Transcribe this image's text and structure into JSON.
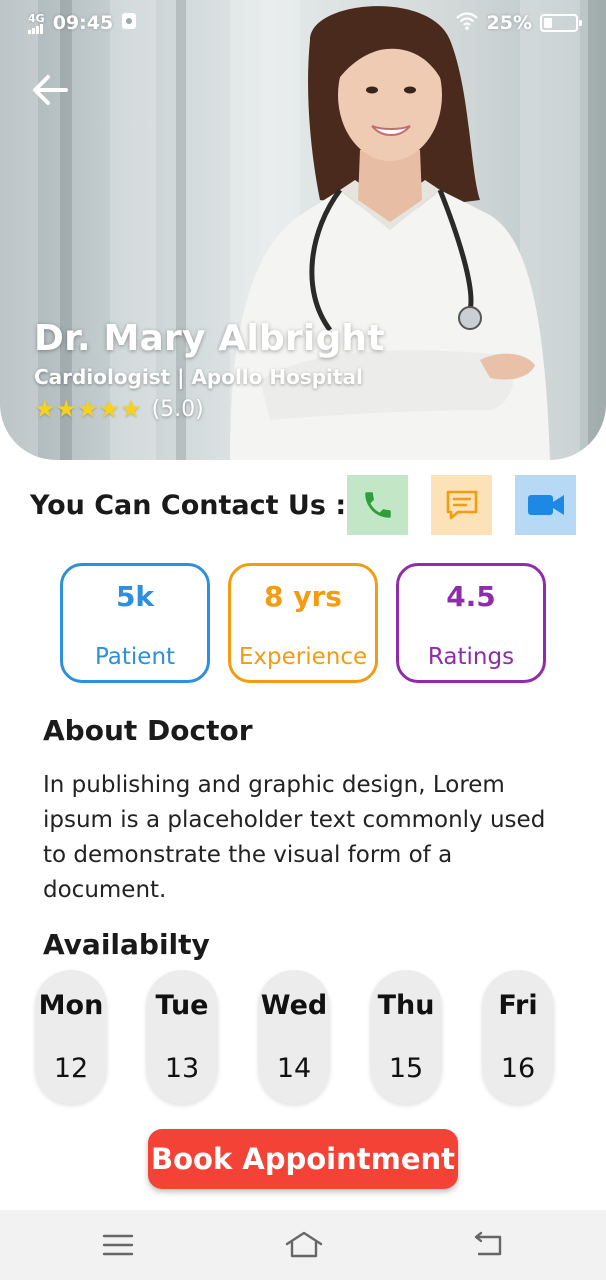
{
  "status_bar": {
    "network": "4G",
    "time": "09:45",
    "battery_text": "25%",
    "battery_level": 0.25,
    "icons": [
      "signal-icon",
      "notification-icon",
      "wifi-icon",
      "battery-icon"
    ]
  },
  "header": {
    "back_icon": "arrow-left-icon"
  },
  "doctor": {
    "name": "Dr. Mary Albright",
    "specialty": "Cardiologist | Apollo Hospital",
    "stars": 5,
    "rating_text": "(5.0)"
  },
  "contact": {
    "label": "You Can Contact Us :",
    "buttons": [
      {
        "name": "phone",
        "icon": "phone-icon",
        "color": "#2e9e3a",
        "bg": "#c3e6c6"
      },
      {
        "name": "chat",
        "icon": "chat-icon",
        "color": "#f39c12",
        "bg": "#fde2b8"
      },
      {
        "name": "video",
        "icon": "video-icon",
        "color": "#1e88e5",
        "bg": "#b8d9f6"
      }
    ]
  },
  "stats": [
    {
      "value": "5k",
      "label": "Patient",
      "color": "#2e8fdc"
    },
    {
      "value": "8 yrs",
      "label": "Experience",
      "color": "#f39c12"
    },
    {
      "value": "4.5",
      "label": "Ratings",
      "color": "#8e2cac"
    }
  ],
  "about": {
    "title": "About Doctor",
    "text": "In publishing and graphic design, Lorem ipsum is a placeholder text commonly used to demonstrate the visual form of a document."
  },
  "availability": {
    "title": "Availabilty",
    "days": [
      {
        "day": "Mon",
        "date": "12"
      },
      {
        "day": "Tue",
        "date": "13"
      },
      {
        "day": "Wed",
        "date": "14"
      },
      {
        "day": "Thu",
        "date": "15"
      },
      {
        "day": "Fri",
        "date": "16"
      }
    ]
  },
  "book_button": {
    "label": "Book Appointment",
    "color": "#f44336"
  },
  "nav_bar": {
    "icons": [
      "menu-icon",
      "home-icon",
      "back-icon"
    ]
  }
}
